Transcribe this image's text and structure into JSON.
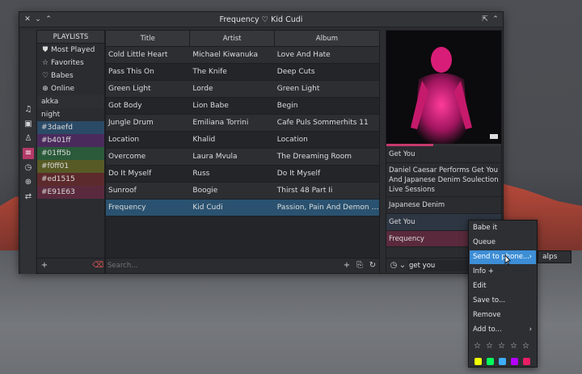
{
  "window": {
    "title": "Frequency ♡ Kid Cudi"
  },
  "playlists": {
    "header": "PLAYLISTS",
    "special": [
      {
        "label": "Most Played",
        "icon": "shield-icon"
      },
      {
        "label": "Favorites",
        "icon": "star-icon"
      },
      {
        "label": "Babes",
        "icon": "heart-icon"
      },
      {
        "label": "Online",
        "icon": "globe-icon"
      }
    ],
    "items": [
      {
        "label": "akka",
        "color": ""
      },
      {
        "label": "night",
        "color": ""
      },
      {
        "label": "#3daefd",
        "color": "#3daefd"
      },
      {
        "label": "#b401ff",
        "color": "#b401ff"
      },
      {
        "label": "#01ff5b",
        "color": "#01ff5b"
      },
      {
        "label": "#f0ff01",
        "color": "#f0ff01"
      },
      {
        "label": "#ed1515",
        "color": "#ed1515"
      },
      {
        "label": "#E91E63",
        "color": "#E91E63"
      }
    ]
  },
  "table": {
    "columns": [
      "Title",
      "Artist",
      "Album"
    ],
    "rows": [
      [
        "Cold Little Heart",
        "Michael Kiwanuka",
        "Love And Hate"
      ],
      [
        "Pass This On",
        "The Knife",
        "Deep Cuts"
      ],
      [
        "Green Light",
        "Lorde",
        "Green Light"
      ],
      [
        "Got Body",
        "Lion Babe",
        "Begin"
      ],
      [
        "Jungle Drum",
        "Emiliana Torrini",
        "Cafe Puls Sommerhits 11"
      ],
      [
        "Location",
        "Khalid",
        "Location"
      ],
      [
        "Overcome",
        "Laura Mvula",
        "The Dreaming Room"
      ],
      [
        "Do It Myself",
        "Russ",
        "Do It Myself"
      ],
      [
        "Sunroof",
        "Boogie",
        "Thirst 48 Part Ii"
      ],
      [
        "Frequency",
        "Kid Cudi",
        "Passion, Pain And Demon Slay…"
      ]
    ],
    "selected_row": 9,
    "search_placeholder": "Search..."
  },
  "right_panel": {
    "results": [
      "Get You",
      "Daniel Caesar Performs Get You And Japanese Denim Soulection Live Sessions",
      "Japanese Denim",
      "Get You",
      "Frequency"
    ],
    "query": "get you"
  },
  "context_menu": {
    "items": [
      "Babe it",
      "Queue",
      "Send to phone...",
      "Info +",
      "Edit",
      "Save to...",
      "Remove",
      "Add to..."
    ],
    "highlighted": "Send to phone...",
    "submenu": [
      "alps"
    ],
    "rating_stars": 5,
    "color_tags": [
      "#f0ff01",
      "#01ff5b",
      "#3daefd",
      "#b401ff",
      "#E91E63"
    ]
  }
}
